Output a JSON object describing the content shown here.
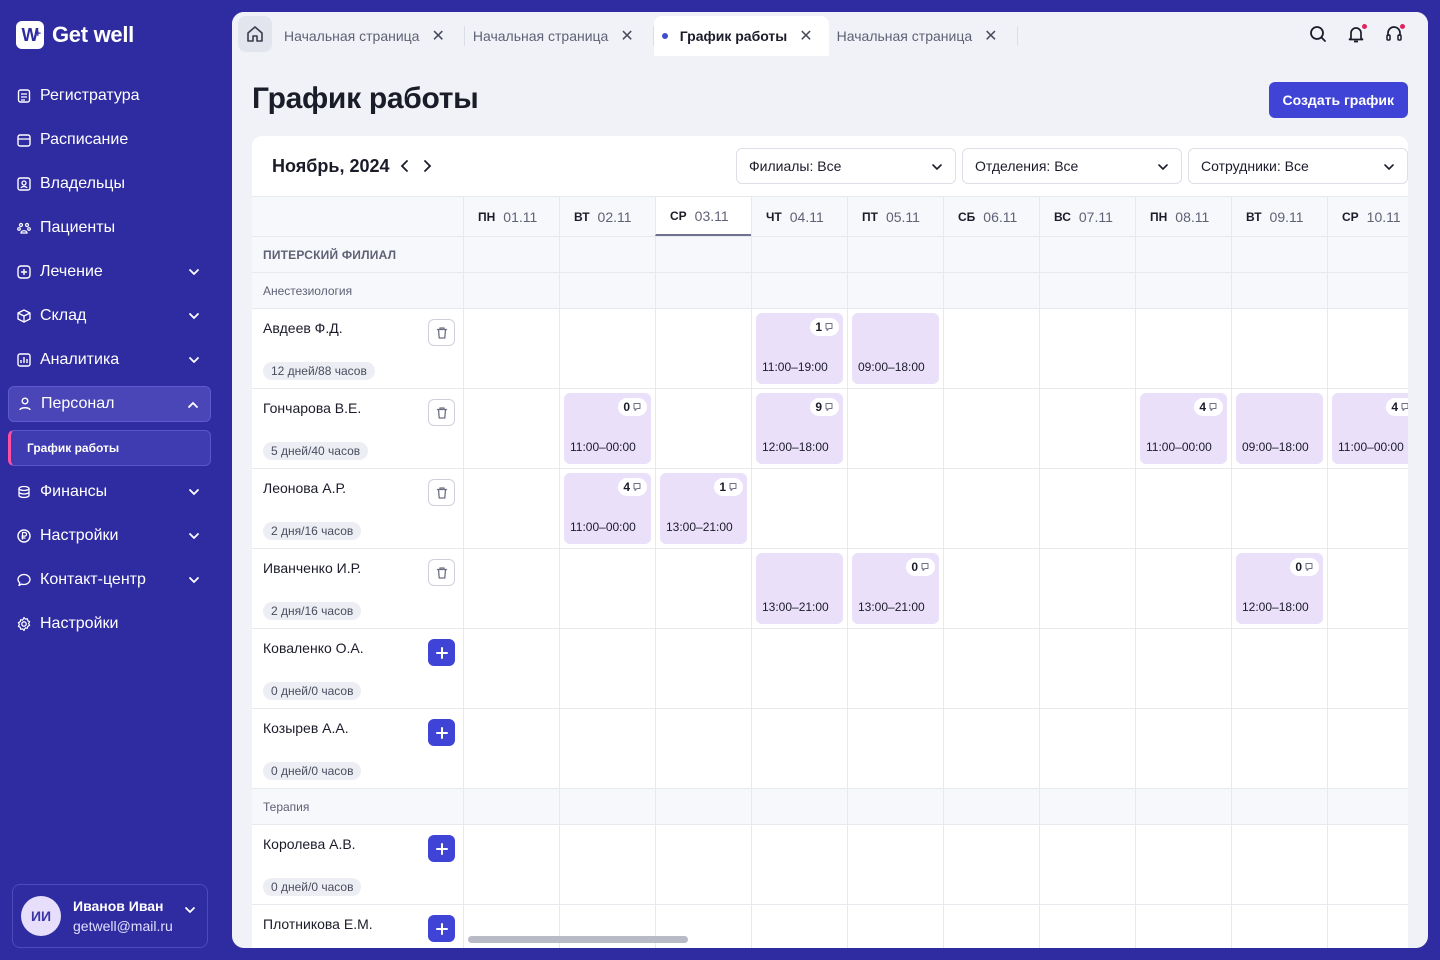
{
  "brand": {
    "name": "Get well",
    "mark": "W",
    "mark_sup": "+"
  },
  "nav": [
    {
      "label": "Регистратура",
      "icon": "registry-icon",
      "chev": false
    },
    {
      "label": "Расписание",
      "icon": "calendar-icon",
      "chev": false
    },
    {
      "label": "Владельцы",
      "icon": "owners-icon",
      "chev": false
    },
    {
      "label": "Пациенты",
      "icon": "paw-icon",
      "chev": false
    },
    {
      "label": "Лечение",
      "icon": "plus-square-icon",
      "chev": true
    },
    {
      "label": "Склад",
      "icon": "box-icon",
      "chev": true
    },
    {
      "label": "Аналитика",
      "icon": "chart-icon",
      "chev": true
    },
    {
      "label": "Персонал",
      "icon": "person-icon",
      "chev": true,
      "active": true
    },
    {
      "label": "График работы",
      "sub": true
    },
    {
      "label": "Финансы",
      "icon": "coins-icon",
      "chev": true
    },
    {
      "label": "Настройки",
      "icon": "ruble-icon",
      "chev": true
    },
    {
      "label": "Контакт-центр",
      "icon": "chat-icon",
      "chev": true
    },
    {
      "label": "Настройки",
      "icon": "gear-icon",
      "chev": false
    }
  ],
  "user": {
    "initials": "ИИ",
    "name": "Иванов Иван",
    "email": "getwell@mail.ru"
  },
  "tabs": [
    {
      "label": "Начальная страница",
      "active": false
    },
    {
      "label": "Начальная страница",
      "active": false
    },
    {
      "label": "График работы",
      "active": true
    },
    {
      "label": "Начальная страница",
      "active": false
    }
  ],
  "page": {
    "title": "График работы",
    "create_label": "Создать график"
  },
  "calendar": {
    "month": "Ноябрь, 2024",
    "filters": [
      "Филиалы: Все",
      "Отделения: Все",
      "Сотрудники: Все"
    ],
    "days": [
      {
        "wd": "ПН",
        "date": "01.11"
      },
      {
        "wd": "ВТ",
        "date": "02.11"
      },
      {
        "wd": "СР",
        "date": "03.11",
        "today": true
      },
      {
        "wd": "ЧТ",
        "date": "04.11"
      },
      {
        "wd": "ПТ",
        "date": "05.11"
      },
      {
        "wd": "СБ",
        "date": "06.11"
      },
      {
        "wd": "ВС",
        "date": "07.11"
      },
      {
        "wd": "ПН",
        "date": "08.11"
      },
      {
        "wd": "ВТ",
        "date": "09.11"
      },
      {
        "wd": "СР",
        "date": "10.11"
      }
    ],
    "rows": [
      {
        "type": "branch",
        "label": "ПИТЕРСКИЙ ФИЛИАЛ"
      },
      {
        "type": "dept",
        "label": "Анестезиология"
      },
      {
        "type": "emp",
        "name": "Авдеев Ф.Д.",
        "hours": "12 дней/88 часов",
        "action": "delete",
        "shifts": {
          "3": {
            "cnt": "1",
            "time": "11:00–19:00"
          },
          "4": {
            "time": "09:00–18:00"
          }
        }
      },
      {
        "type": "emp",
        "name": "Гончарова В.Е.",
        "hours": "5 дней/40 часов",
        "action": "delete",
        "shifts": {
          "1": {
            "cnt": "0",
            "time": "11:00–00:00"
          },
          "3": {
            "cnt": "9",
            "time": "12:00–18:00"
          },
          "7": {
            "cnt": "4",
            "time": "11:00–00:00"
          },
          "8": {
            "time": "09:00–18:00"
          },
          "9": {
            "cnt": "4",
            "time": "11:00–00:00"
          }
        }
      },
      {
        "type": "emp",
        "name": "Леонова А.Р.",
        "hours": "2 дня/16 часов",
        "action": "delete",
        "shifts": {
          "1": {
            "cnt": "4",
            "time": "11:00–00:00"
          },
          "2": {
            "cnt": "1",
            "time": "13:00–21:00"
          }
        }
      },
      {
        "type": "emp",
        "name": "Иванченко И.Р.",
        "hours": "2 дня/16 часов",
        "action": "delete",
        "shifts": {
          "3": {
            "time": "13:00–21:00"
          },
          "4": {
            "cnt": "0",
            "time": "13:00–21:00"
          },
          "8": {
            "cnt": "0",
            "time": "12:00–18:00"
          }
        }
      },
      {
        "type": "emp",
        "name": "Коваленко О.А.",
        "hours": "0 дней/0 часов",
        "action": "add",
        "shifts": {}
      },
      {
        "type": "emp",
        "name": "Козырев А.А.",
        "hours": "0 дней/0 часов",
        "action": "add",
        "shifts": {}
      },
      {
        "type": "dept",
        "label": "Терапия"
      },
      {
        "type": "emp",
        "name": "Королева А.В.",
        "hours": "0 дней/0 часов",
        "action": "add",
        "shifts": {}
      },
      {
        "type": "emp",
        "name": "Плотникова Е.М.",
        "hours": "",
        "action": "add",
        "shifts": {}
      }
    ]
  }
}
